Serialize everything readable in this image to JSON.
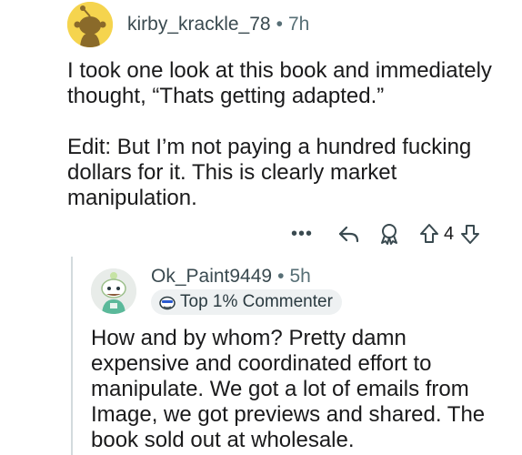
{
  "parent_comment": {
    "author": "kirby_krackle_78",
    "separator": "•",
    "time": "7h",
    "paragraphs": [
      "I took one look at this book and immediately thought, “Thats getting adapted.”",
      "Edit: But I’m not paying a hundred fucking dollars for it. This is clearly market manipulation."
    ],
    "actions": {
      "more_label": "•••",
      "vote_count": "4"
    },
    "avatar_color": "#f5d44e"
  },
  "reply_comment": {
    "author": "Ok_Paint9449",
    "separator": "•",
    "time": "5h",
    "badge_label": "Top 1% Commenter",
    "text": "How and by whom? Pretty damn expensive and coordinated effort to manipulate. We got a lot of emails from Image, we got previews and shared. The book sold out at wholesale.",
    "avatar_color": "#e8ece9"
  },
  "colors": {
    "meta_gray": "#576f76",
    "thread_line": "#d3dadd",
    "badge_bg": "#eef1f2"
  }
}
